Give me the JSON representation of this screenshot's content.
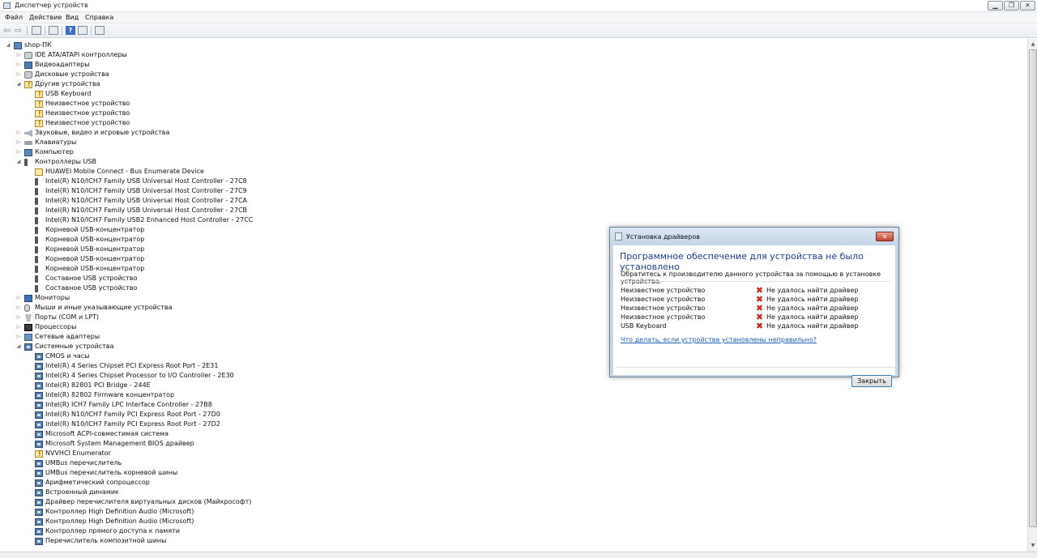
{
  "window": {
    "title": "Диспетчер устройств",
    "controls": [
      "▁",
      "❐",
      "✕"
    ]
  },
  "menu": [
    "Файл",
    "Действие",
    "Вид",
    "Справка"
  ],
  "toolbar": {
    "back_glyph": "⇦",
    "forward_glyph": "⇨",
    "help_glyph": "?",
    "icons": [
      "back-arrow-icon",
      "forward-arrow-icon",
      "properties-icon",
      "tree-view-icon",
      "help-icon",
      "show-hidden-icon",
      "scan-hardware-icon"
    ]
  },
  "tree": {
    "root": "shop-ПК",
    "categories": [
      {
        "label": "IDE ATA/ATAPI контроллеры",
        "icon": "disk",
        "expanded": false,
        "children": []
      },
      {
        "label": "Видеоадаптеры",
        "icon": "video",
        "expanded": false,
        "children": []
      },
      {
        "label": "Дисковые устройства",
        "icon": "disk",
        "expanded": false,
        "children": []
      },
      {
        "label": "Другие устройства",
        "icon": "unknown",
        "expanded": true,
        "children": [
          {
            "label": "USB Keyboard",
            "icon": "unknown"
          },
          {
            "label": "Неизвестное устройство",
            "icon": "unknown"
          },
          {
            "label": "Неизвестное устройство",
            "icon": "unknown"
          },
          {
            "label": "Неизвестное устройство",
            "icon": "unknown"
          }
        ]
      },
      {
        "label": "Звуковые, видео и игровые устройства",
        "icon": "sound",
        "expanded": false,
        "children": []
      },
      {
        "label": "Клавиатуры",
        "icon": "keyboard",
        "expanded": false,
        "children": []
      },
      {
        "label": "Компьютер",
        "icon": "computer",
        "expanded": false,
        "children": []
      },
      {
        "label": "Контроллеры USB",
        "icon": "usb",
        "expanded": true,
        "children": [
          {
            "label": "HUAWEI Mobile Connect - Bus Enumerate Device",
            "icon": "usbwarn"
          },
          {
            "label": "Intel(R) N10/ICH7 Family USB Universal Host Controller - 27C8",
            "icon": "usb"
          },
          {
            "label": "Intel(R) N10/ICH7 Family USB Universal Host Controller - 27C9",
            "icon": "usb"
          },
          {
            "label": "Intel(R) N10/ICH7 Family USB Universal Host Controller - 27CA",
            "icon": "usb"
          },
          {
            "label": "Intel(R) N10/ICH7 Family USB Universal Host Controller - 27CB",
            "icon": "usb"
          },
          {
            "label": "Intel(R) N10/ICH7 Family USB2 Enhanced Host Controller - 27CC",
            "icon": "usb"
          },
          {
            "label": "Корневой USB-концентратор",
            "icon": "usb"
          },
          {
            "label": "Корневой USB-концентратор",
            "icon": "usb"
          },
          {
            "label": "Корневой USB-концентратор",
            "icon": "usb"
          },
          {
            "label": "Корневой USB-концентратор",
            "icon": "usb"
          },
          {
            "label": "Корневой USB-концентратор",
            "icon": "usb"
          },
          {
            "label": "Составное USB устройство",
            "icon": "usb"
          },
          {
            "label": "Составное USB устройство",
            "icon": "usb"
          }
        ]
      },
      {
        "label": "Мониторы",
        "icon": "monitor",
        "expanded": false,
        "children": []
      },
      {
        "label": "Мыши и иные указывающие устройства",
        "icon": "mouse",
        "expanded": false,
        "children": []
      },
      {
        "label": "Порты (COM и LPT)",
        "icon": "port",
        "expanded": false,
        "children": []
      },
      {
        "label": "Процессоры",
        "icon": "cpu",
        "expanded": false,
        "children": []
      },
      {
        "label": "Сетевые адаптеры",
        "icon": "net",
        "expanded": false,
        "children": []
      },
      {
        "label": "Системные устройства",
        "icon": "sys",
        "expanded": true,
        "children": [
          {
            "label": "CMOS и часы",
            "icon": "sys"
          },
          {
            "label": "Intel(R) 4 Series Chipset PCI Express Root Port - 2E31",
            "icon": "sys"
          },
          {
            "label": "Intel(R) 4 Series Chipset Processor to I/O Controller - 2E30",
            "icon": "sys"
          },
          {
            "label": "Intel(R) 82801 PCI Bridge - 244E",
            "icon": "sys"
          },
          {
            "label": "Intel(R) 82802 Firmware концентратор",
            "icon": "sys"
          },
          {
            "label": "Intel(R) ICH7 Family LPC Interface Controller - 27B8",
            "icon": "sys"
          },
          {
            "label": "Intel(R) N10/ICH7 Family PCI Express Root Port - 27D0",
            "icon": "sys"
          },
          {
            "label": "Intel(R) N10/ICH7 Family PCI Express Root Port - 27D2",
            "icon": "sys"
          },
          {
            "label": "Microsoft ACPI-совместимая система",
            "icon": "sys"
          },
          {
            "label": "Microsoft System Management BIOS драйвер",
            "icon": "sys"
          },
          {
            "label": "NVVHCI Enumerator",
            "icon": "unknown"
          },
          {
            "label": "UMBus перечислитель",
            "icon": "sys"
          },
          {
            "label": "UMBus перечислитель корневой шины",
            "icon": "sys"
          },
          {
            "label": "Арифметический сопроцессор",
            "icon": "sys"
          },
          {
            "label": "Встроенный динамик",
            "icon": "sys"
          },
          {
            "label": "Драйвер перечислителя виртуальных дисков (Майкрософт)",
            "icon": "sys"
          },
          {
            "label": "Контроллер High Definition Audio (Microsoft)",
            "icon": "sys"
          },
          {
            "label": "Контроллер High Definition Audio (Microsoft)",
            "icon": "sys"
          },
          {
            "label": "Контроллер прямого доступа к памяти",
            "icon": "sys"
          },
          {
            "label": "Перечислитель композитной шины",
            "icon": "sys"
          }
        ]
      }
    ]
  },
  "dialog": {
    "title": "Установка драйверов",
    "close_glyph": "✕",
    "heading": "Программное обеспечение для устройства не было установлено",
    "subtitle": "Обратитесь к производителю данного устройства за помощью в установке устройства.",
    "devices": [
      {
        "name": "Неизвестное устройство",
        "status": "Не удалось найти драйвер"
      },
      {
        "name": "Неизвестное устройство",
        "status": "Не удалось найти драйвер"
      },
      {
        "name": "Неизвестное устройство",
        "status": "Не удалось найти драйвер"
      },
      {
        "name": "Неизвестное устройство",
        "status": "Не удалось найти драйвер"
      },
      {
        "name": "USB Keyboard",
        "status": "Не удалось найти драйвер"
      }
    ],
    "error_glyph": "✖",
    "link": "Что делать, если устройства установлены неправильно?",
    "close_button": "Закрыть"
  },
  "colors": {
    "heading": "#1a3e8a",
    "link": "#1a5fb4",
    "error": "#d1261e"
  }
}
